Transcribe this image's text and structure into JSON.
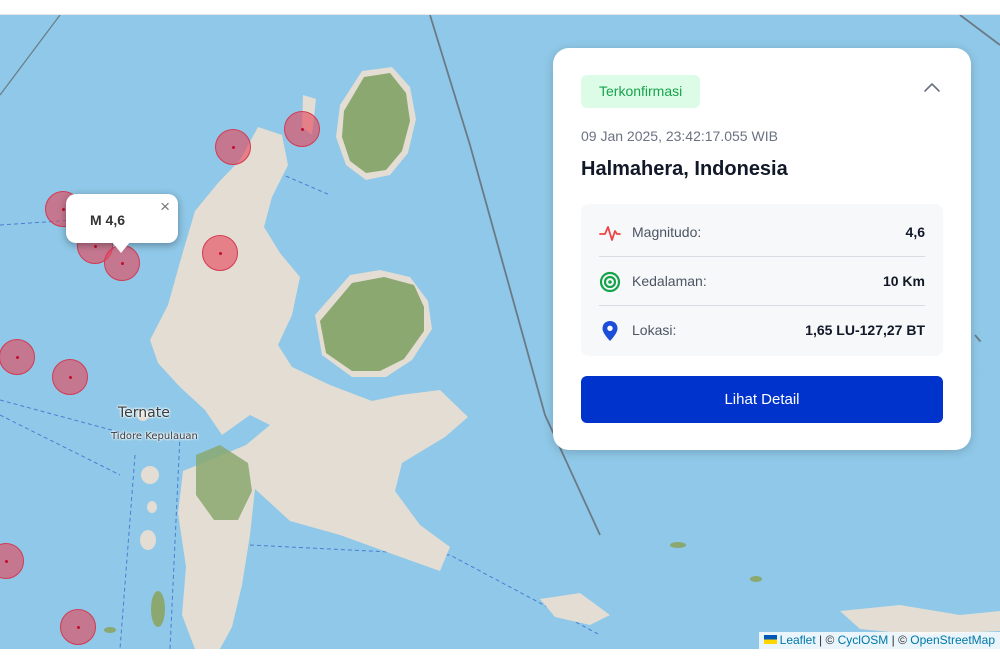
{
  "map": {
    "labels": {
      "big_town": "Ternate",
      "small_town": "Tidore Kepulauan"
    },
    "popup": {
      "text": "M 4,6",
      "close": "×"
    },
    "attribution": {
      "leaflet": "Leaflet",
      "sep1": " | © ",
      "cyclosm": "CyclOSM",
      "sep2": " | © ",
      "osm": "OpenStreetMap"
    },
    "colors": {
      "sea": "#8fc8e8",
      "land": "#e3ddd3",
      "forest": "#8aa86f",
      "marker": "#e6465a"
    }
  },
  "card": {
    "status": "Terkonfirmasi",
    "datetime": "09 Jan 2025, 23:42:17.055 WIB",
    "region": "Halmahera, Indonesia",
    "rows": [
      {
        "label": "Magnitudo:",
        "value": "4,6",
        "icon": "pulse-icon"
      },
      {
        "label": "Kedalaman:",
        "value": "10 Km",
        "icon": "target-icon"
      },
      {
        "label": "Lokasi:",
        "value": "1,65 LU-127,27 BT",
        "icon": "location-pin-icon"
      }
    ],
    "button": "Lihat Detail",
    "colors": {
      "badge_bg": "#dcfce7",
      "badge_text": "#16a34a",
      "button": "#0033cc",
      "pulse": "#ef4444",
      "target": "#16a34a",
      "pin": "#1d4ed8"
    }
  }
}
